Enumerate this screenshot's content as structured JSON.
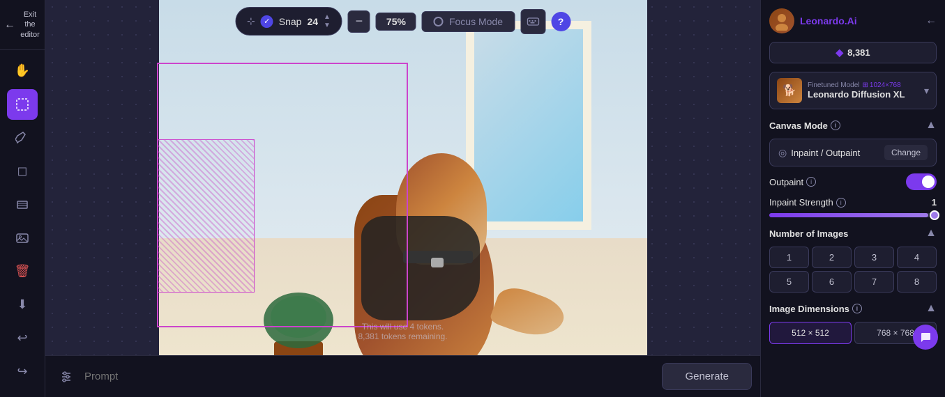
{
  "exit": {
    "label": "Exit the editor",
    "arrow": "←"
  },
  "tools": [
    {
      "name": "hand-tool",
      "icon": "✋",
      "active": false
    },
    {
      "name": "select-tool",
      "icon": "⊹",
      "active": true
    },
    {
      "name": "brush-tool",
      "icon": "✏",
      "active": false
    },
    {
      "name": "eraser-tool",
      "icon": "◻",
      "active": false
    },
    {
      "name": "text-tool",
      "icon": "T",
      "active": false
    },
    {
      "name": "layers-tool",
      "icon": "⊞",
      "active": false
    },
    {
      "name": "image-tool",
      "icon": "🖼",
      "active": false
    },
    {
      "name": "delete-tool",
      "icon": "🗑",
      "active": false,
      "danger": true
    },
    {
      "name": "download-tool",
      "icon": "⬇",
      "active": false
    },
    {
      "name": "undo-tool",
      "icon": "↩",
      "active": false
    },
    {
      "name": "redo-tool",
      "icon": "↪",
      "active": false
    }
  ],
  "snap": {
    "label": "Snap",
    "value": "24",
    "checked": true
  },
  "zoom": {
    "minus_label": "−",
    "percent": "75%",
    "plus_label": "+"
  },
  "focus_mode": {
    "label": "Focus Mode"
  },
  "token_notice": {
    "line1": "This will use 4 tokens.",
    "line2": "8,381 tokens remaining."
  },
  "bottom_bar": {
    "prompt_placeholder": "Prompt",
    "generate_label": "Generate"
  },
  "right_panel": {
    "user": {
      "name": "Leonardo",
      "brand": ".Ai",
      "avatar_emoji": "👤"
    },
    "token_balance": {
      "icon": "◆",
      "value": "8,381"
    },
    "model": {
      "label": "Finetuned Model",
      "name": "Leonardo Diffusion XL",
      "size": "1024×768",
      "size_icon": "⊞",
      "thumb_emoji": "🐕"
    },
    "canvas_mode": {
      "title": "Canvas Mode",
      "mode_label": "Inpaint / Outpaint",
      "mode_icon": "◎",
      "change_label": "Change"
    },
    "outpaint": {
      "title": "Outpaint",
      "toggle_on": true
    },
    "inpaint_strength": {
      "title": "Inpaint Strength",
      "value": "1",
      "fill_percent": 95
    },
    "num_images": {
      "title": "Number of Images",
      "options": [
        "1",
        "2",
        "3",
        "4",
        "5",
        "6",
        "7",
        "8"
      ]
    },
    "image_dimensions": {
      "title": "Image Dimensions",
      "options": [
        {
          "label": "512 × 512",
          "active": true
        },
        {
          "label": "768 × 768",
          "active": false
        }
      ]
    }
  }
}
